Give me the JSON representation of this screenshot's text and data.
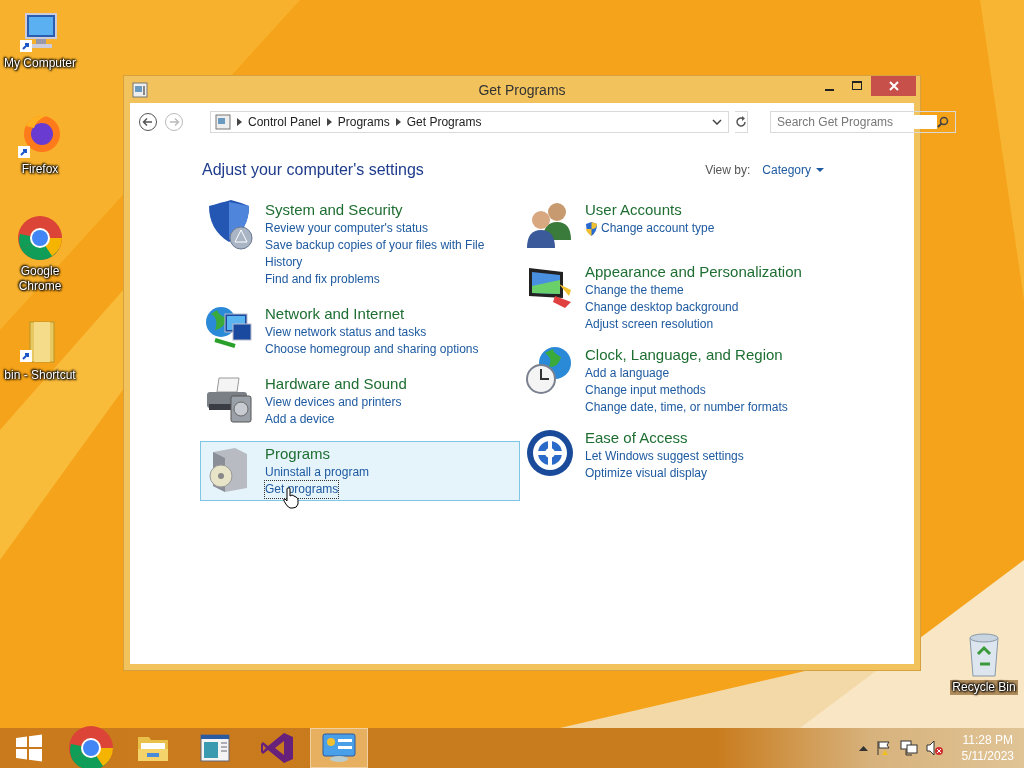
{
  "desktop_icons": [
    {
      "kind": "computer",
      "label": "My Computer"
    },
    {
      "kind": "firefox",
      "label": "Firefox"
    },
    {
      "kind": "chrome",
      "label": "Google Chrome"
    },
    {
      "kind": "folder",
      "label": "bin - Shortcut"
    },
    {
      "kind": "recycle",
      "label": "Recycle Bin"
    }
  ],
  "window": {
    "title": "Get Programs",
    "breadcrumbs": [
      "Control Panel",
      "Programs",
      "Get Programs"
    ],
    "search": {
      "placeholder": "Search Get Programs"
    },
    "heading": "Adjust your computer's settings",
    "view_by": {
      "label": "View by:",
      "value": "Category"
    },
    "columns": [
      [
        {
          "kind": "shield",
          "title": "System and Security",
          "selected": false,
          "links": [
            {
              "text": "Review your computer's status",
              "focused": false
            },
            {
              "text": "Save backup copies of your files with File History",
              "focused": false
            },
            {
              "text": "Find and fix problems",
              "focused": false
            }
          ]
        },
        {
          "kind": "globe",
          "title": "Network and Internet",
          "selected": false,
          "links": [
            {
              "text": "View network status and tasks",
              "focused": false
            },
            {
              "text": "Choose homegroup and sharing options",
              "focused": false
            }
          ]
        },
        {
          "kind": "printer",
          "title": "Hardware and Sound",
          "selected": false,
          "links": [
            {
              "text": "View devices and printers",
              "focused": false
            },
            {
              "text": "Add a device",
              "focused": false
            }
          ]
        },
        {
          "kind": "box",
          "title": "Programs",
          "selected": true,
          "links": [
            {
              "text": "Uninstall a program",
              "focused": false
            },
            {
              "text": "Get programs",
              "focused": true
            }
          ]
        }
      ],
      [
        {
          "kind": "users",
          "title": "User Accounts",
          "selected": false,
          "links": [
            {
              "text": "Change account type",
              "focused": false,
              "shield": true
            }
          ]
        },
        {
          "kind": "monitor",
          "title": "Appearance and Personalization",
          "selected": false,
          "links": [
            {
              "text": "Change the theme",
              "focused": false
            },
            {
              "text": "Change desktop background",
              "focused": false
            },
            {
              "text": "Adjust screen resolution",
              "focused": false
            }
          ]
        },
        {
          "kind": "clock",
          "title": "Clock, Language, and Region",
          "selected": false,
          "links": [
            {
              "text": "Add a language",
              "focused": false
            },
            {
              "text": "Change input methods",
              "focused": false
            },
            {
              "text": "Change date, time, or number formats",
              "focused": false
            }
          ]
        },
        {
          "kind": "ease",
          "title": "Ease of Access",
          "selected": false,
          "links": [
            {
              "text": "Let Windows suggest settings",
              "focused": false
            },
            {
              "text": "Optimize visual display",
              "focused": false
            }
          ]
        }
      ]
    ]
  },
  "taskbar": {
    "apps": [
      {
        "kind": "chrome",
        "selected": false
      },
      {
        "kind": "explorer",
        "selected": false
      },
      {
        "kind": "document",
        "selected": false
      },
      {
        "kind": "studio",
        "selected": false
      },
      {
        "kind": "panel",
        "selected": true
      }
    ],
    "time": "11:28 PM",
    "date": "5/11/2023"
  }
}
